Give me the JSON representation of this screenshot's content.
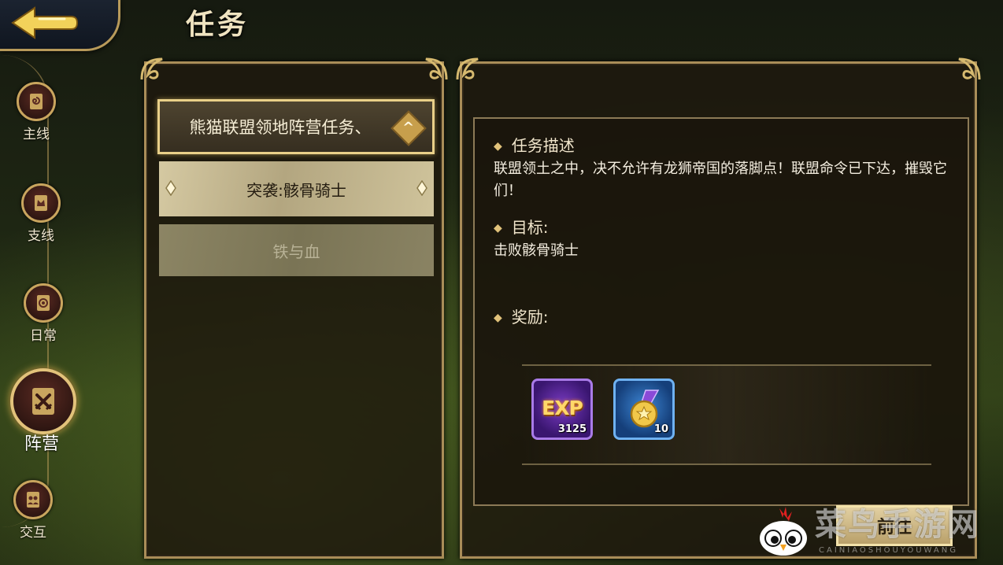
{
  "header": {
    "title": "任务"
  },
  "nav": {
    "items": [
      {
        "label": "主线",
        "icon": "scroll-spiral-icon"
      },
      {
        "label": "支线",
        "icon": "scroll-crown-icon"
      },
      {
        "label": "日常",
        "icon": "scroll-swirl-icon"
      },
      {
        "label": "阵营",
        "icon": "crossed-swords-icon",
        "active": true
      },
      {
        "label": "交互",
        "icon": "scroll-people-icon"
      }
    ]
  },
  "quest_list": {
    "group_title": "熊猫联盟领地阵营任务、",
    "selected_quest": "突袭:骸骨骑士",
    "other_quest": "铁与血"
  },
  "detail": {
    "description_title": "任务描述",
    "description_text": "联盟领土之中，决不允许有龙狮帝国的落脚点！联盟命令已下达，摧毁它们！",
    "goal_title": "目标:",
    "goal_text": "击败骸骨骑士",
    "reward_title": "奖励:",
    "rewards": [
      {
        "icon": "exp-icon",
        "label": "EXP",
        "count": "3125"
      },
      {
        "icon": "medal-icon",
        "count": "10"
      }
    ]
  },
  "go_button": {
    "label": "前往"
  },
  "watermark": {
    "text": "菜鸟手游网",
    "subtext": "CAINIAOSHOUYOUWANG"
  },
  "colors": {
    "gold": "#c9a55e",
    "panel": "#1e180e",
    "exp_purple": "#7b3cc4",
    "medal_blue": "#3d86d4"
  }
}
